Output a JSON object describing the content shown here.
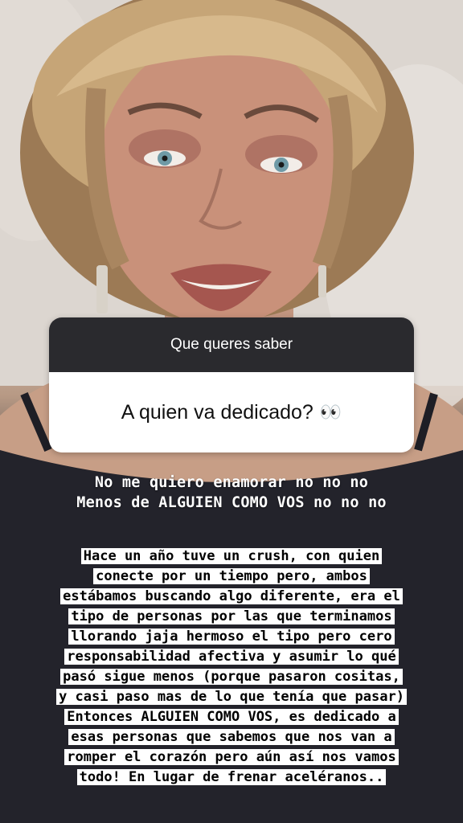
{
  "question_sticker": {
    "title": "Que queres saber",
    "answer": "A quien va dedicado?",
    "emoji": "👀"
  },
  "lyrics": [
    "No me quiero enamorar no no no",
    "Menos de ALGUIEN COMO VOS no no no"
  ],
  "story_lines": [
    "Hace un año tuve un crush, con quien",
    "conecte por un tiempo pero, ambos",
    "estábamos buscando algo diferente, era el",
    "tipo de personas por las que terminamos",
    "llorando jaja hermoso el tipo pero cero",
    "responsabilidad afectiva y asumir lo qué",
    "pasó sigue menos (porque pasaron cositas,",
    "y casi paso mas de lo que tenía que pasar)",
    "Entonces ALGUIEN COMO VOS, es dedicado a",
    "esas personas que sabemos que nos van a",
    "romper el corazón pero aún así nos vamos",
    "todo! En lugar de frenar aceléranos.."
  ]
}
